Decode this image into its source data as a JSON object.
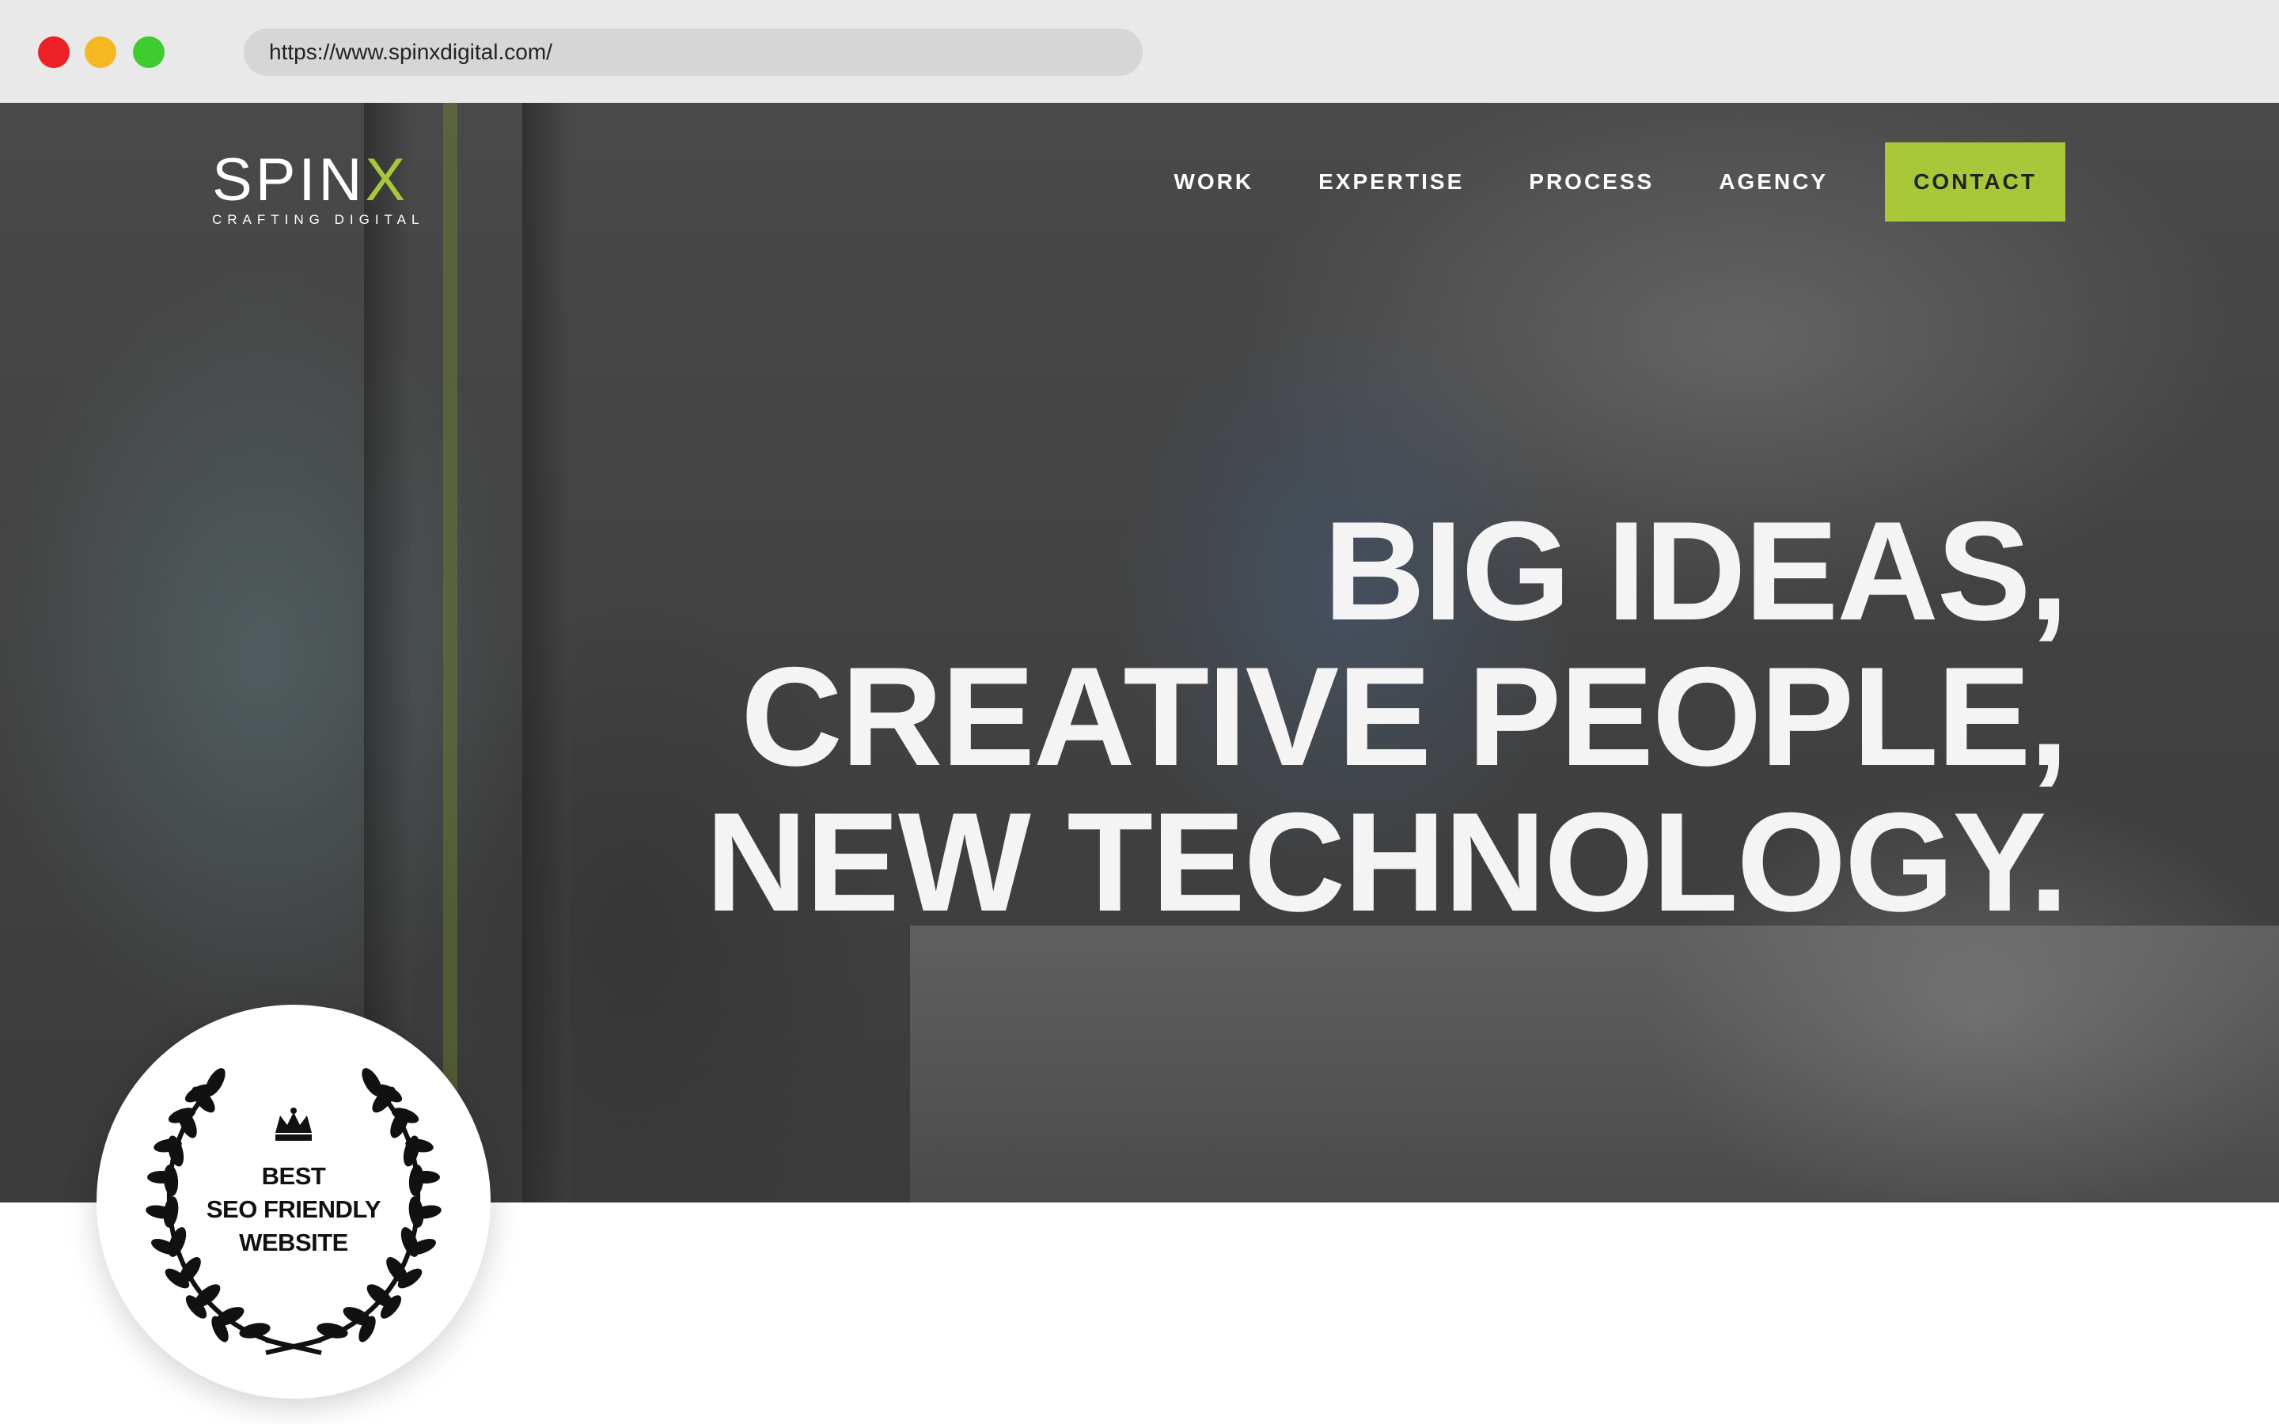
{
  "browser": {
    "url": "https://www.spinxdigital.com/"
  },
  "logo": {
    "word_main": "SPIN",
    "word_accent": "X",
    "tagline": "CRAFTING DIGITAL"
  },
  "nav": {
    "items": [
      {
        "label": "WORK"
      },
      {
        "label": "EXPERTISE"
      },
      {
        "label": "PROCESS"
      },
      {
        "label": "AGENCY"
      }
    ],
    "cta_label": "CONTACT"
  },
  "hero": {
    "headline_lines": [
      "BIG IDEAS,",
      "CREATIVE PEOPLE,",
      "NEW TECHNOLOGY."
    ]
  },
  "badge": {
    "lines": [
      "BEST",
      "SEO FRIENDLY",
      "WEBSITE"
    ]
  },
  "colors": {
    "accent": "#a8c83a",
    "close": "#ec2026",
    "minimize": "#f6b821",
    "maximize": "#3fcc2f"
  },
  "icons": [
    "crown-icon",
    "laurel-wreath-icon"
  ]
}
